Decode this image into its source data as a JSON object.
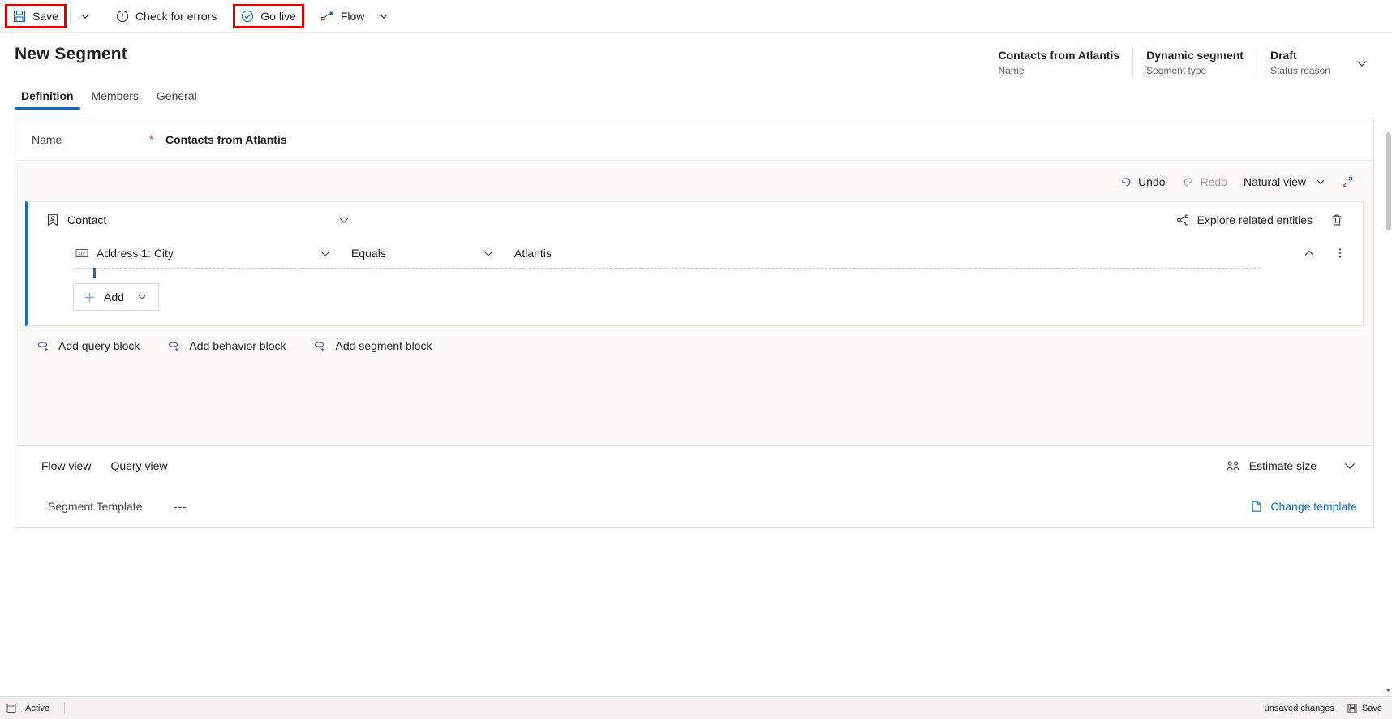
{
  "commandbar": {
    "save_label": "Save",
    "check_errors_label": "Check for errors",
    "go_live_label": "Go live",
    "flow_label": "Flow"
  },
  "header": {
    "page_title": "New Segment",
    "fields": [
      {
        "value": "Contacts from Atlantis",
        "label": "Name"
      },
      {
        "value": "Dynamic segment",
        "label": "Segment type"
      },
      {
        "value": "Draft",
        "label": "Status reason"
      }
    ]
  },
  "tabs": [
    {
      "label": "Definition",
      "active": true
    },
    {
      "label": "Members",
      "active": false
    },
    {
      "label": "General",
      "active": false
    }
  ],
  "name_field": {
    "label": "Name",
    "required_marker": "*",
    "value": "Contacts from Atlantis"
  },
  "builder_toolbar": {
    "undo_label": "Undo",
    "redo_label": "Redo",
    "view_label": "Natural view"
  },
  "query_block": {
    "entity_label": "Contact",
    "explore_label": "Explore related entities",
    "condition": {
      "attribute": "Address 1: City",
      "operator": "Equals",
      "value": "Atlantis"
    },
    "add_label": "Add"
  },
  "block_links": [
    {
      "label": "Add query block"
    },
    {
      "label": "Add behavior block"
    },
    {
      "label": "Add segment block"
    }
  ],
  "view_bar": {
    "flow_view_label": "Flow view",
    "query_view_label": "Query view",
    "estimate_label": "Estimate size"
  },
  "template_row": {
    "label": "Segment Template",
    "value": "---",
    "change_label": "Change template"
  },
  "statusbar": {
    "state_label": "Active",
    "unsaved_label": "unsaved changes",
    "save_label": "Save"
  },
  "colors": {
    "accent": "#0f6cbd",
    "highlight": "#e00000",
    "required": "#d13438",
    "disabled": "#a19f9d"
  }
}
